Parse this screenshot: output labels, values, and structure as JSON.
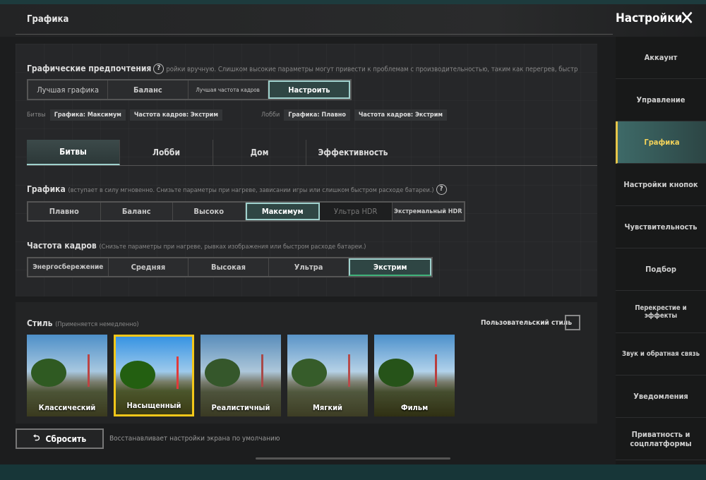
{
  "header": {
    "section_title": "Графика",
    "settings_title": "Настройки",
    "close_icon": "close-icon"
  },
  "preferences": {
    "title": "Графические предпочтения",
    "note": "ройки вручную. Слишком высокие параметры могут привести к проблемам с производительностью, таким как перегрев, быстр",
    "options": [
      "Лучшая графика",
      "Баланс",
      "Лучшая частота кадров",
      "Настроить"
    ],
    "selected": "Настроить",
    "battle_label": "Битвы",
    "battle_tags": [
      "Графика: Максимум",
      "Частота кадров: Экстрим"
    ],
    "lobby_label": "Лобби",
    "lobby_tags": [
      "Графика: Плавно",
      "Частота кадров: Экстрим"
    ]
  },
  "tabs": [
    {
      "label": "Битвы"
    },
    {
      "label": "Лобби"
    },
    {
      "label": "Дом"
    },
    {
      "label": "Эффективность"
    }
  ],
  "graphics": {
    "label": "Графика",
    "hint": "(вступает в силу мгновенно. Снизьте параметры при нагреве, зависании игры или слишком быстром расходе батареи.)",
    "options": [
      "Плавно",
      "Баланс",
      "Высоко",
      "Максимум",
      "Ультра HDR",
      "Экстремальный HDR"
    ],
    "selected": "Максимум"
  },
  "framerate": {
    "label": "Частота кадров",
    "hint": "(Снизьте параметры при нагреве, рывках изображения или быстром расходе батареи.)",
    "options": [
      "Энергосбережение",
      "Средняя",
      "Высокая",
      "Ультра",
      "Экстрим"
    ],
    "selected": "Экстрим"
  },
  "style": {
    "label": "Стиль",
    "hint": "(Применяется немедленно)",
    "custom_label": "Пользовательский стиль",
    "custom_checked": false,
    "options": [
      "Классический",
      "Насыщенный",
      "Реалистичный",
      "Мягкий",
      "Фильм"
    ],
    "selected": "Насыщенный"
  },
  "reset": {
    "label": "Сбросить",
    "description": "Восстанавливает настройки экрана по умолчанию",
    "icon": "undo-icon"
  },
  "sidebar": {
    "items": [
      {
        "label": "Аккаунт"
      },
      {
        "label": "Управление"
      },
      {
        "label": "Графика"
      },
      {
        "label": "Настройки кнопок"
      },
      {
        "label": "Чувствительность"
      },
      {
        "label": "Подбор"
      },
      {
        "label": "Перекрестие и эффекты"
      },
      {
        "label": "Звук и обратная связь"
      },
      {
        "label": "Уведомления"
      },
      {
        "label": "Приватность и соцплатформы"
      }
    ],
    "selected": "Графика",
    "accent": "#e6c64a"
  }
}
